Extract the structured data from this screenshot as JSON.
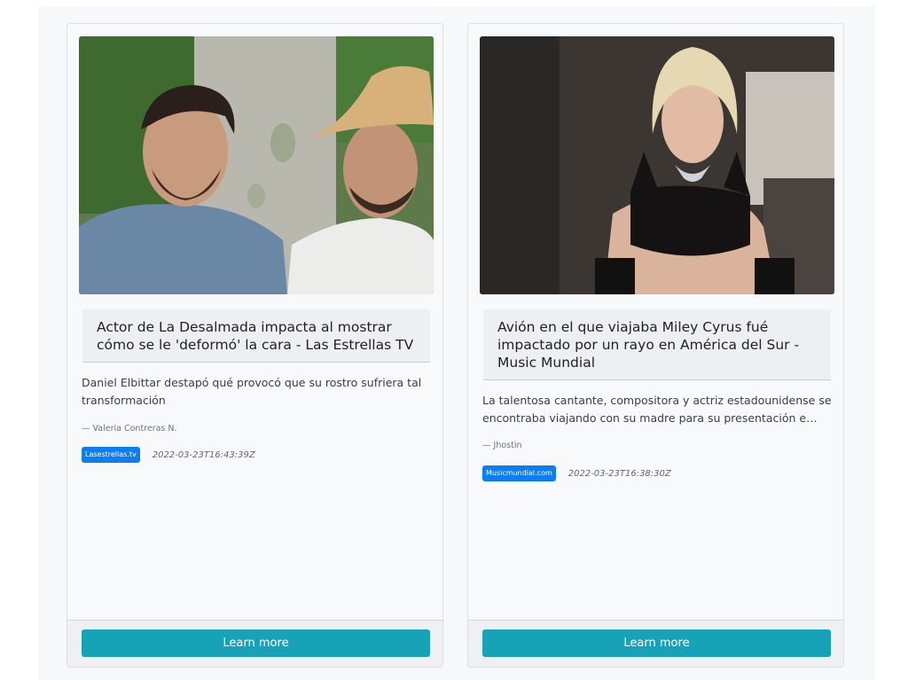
{
  "cards": [
    {
      "title": "Actor de La Desalmada impacta al mostrar cómo se le 'deformó' la cara - Las Estrellas TV",
      "description": "Daniel Elbittar destapó qué provocó que su rostro sufriera tal transformación",
      "author": "— Valeria Contreras N.",
      "source_badge": "Lasestrellas.tv",
      "date": "2022-03-23T16:43:39Z",
      "button_label": "Learn more",
      "image_alt": "two-men-photo"
    },
    {
      "title": "Avión en el que viajaba Miley Cyrus fué impactado por un rayo en América del Sur - Music Mundial",
      "description_line1": "La talentosa cantante, compositora y actriz estadounidense se",
      "description_line2": "encontraba viajando con su madre para su presentación en u...",
      "author": "— Jhostin",
      "source_badge": "Musicmundial.com",
      "date": "2022-03-23T16:38:30Z",
      "button_label": "Learn more",
      "image_alt": "woman-runway-photo"
    }
  ],
  "colors": {
    "badge": "#0d7ef2",
    "button": "#17a2b8",
    "title_bg": "#eeeff1"
  }
}
